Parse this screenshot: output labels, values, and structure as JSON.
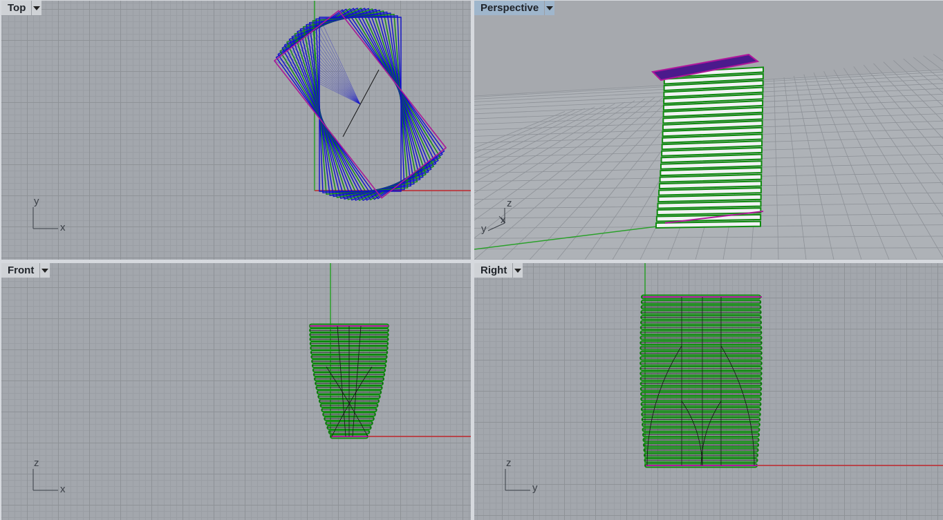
{
  "viewports": {
    "top": {
      "title": "Top",
      "axis_h": "x",
      "axis_v": "y"
    },
    "perspective": {
      "title": "Perspective",
      "axis_x": "x",
      "axis_y": "y",
      "axis_z": "z"
    },
    "front": {
      "title": "Front",
      "axis_h": "x",
      "axis_v": "z"
    },
    "right": {
      "title": "Right",
      "axis_h": "y",
      "axis_v": "z"
    }
  },
  "colors": {
    "viewport_bg": "#a3a7ad",
    "tab_bg": "#cfd2d6",
    "tab_active_bg": "#9fb6cc",
    "x_axis": "#c0272d",
    "y_axis": "#2aa02a",
    "contour_green": "#0f8a0f",
    "contour_blue": "#1010c8",
    "contour_magenta": "#b0179b",
    "top_face": "#4b1a8c"
  },
  "icons": {
    "dropdown": "chevron-down-icon"
  }
}
